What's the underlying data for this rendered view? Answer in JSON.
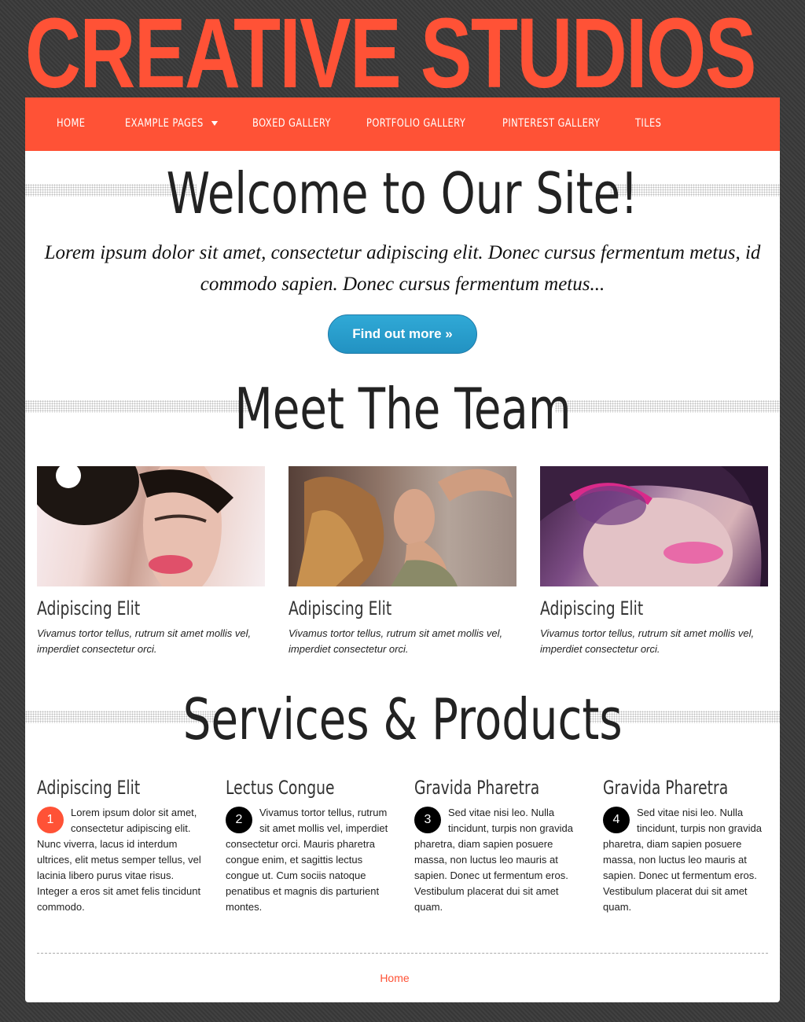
{
  "site": {
    "title": "CREATIVE STUDIOS"
  },
  "nav": {
    "items": [
      {
        "label": "HOME"
      },
      {
        "label": "EXAMPLE PAGES"
      },
      {
        "label": "BOXED GALLERY"
      },
      {
        "label": "PORTFOLIO GALLERY"
      },
      {
        "label": "PINTEREST GALLERY"
      },
      {
        "label": "TILES"
      }
    ]
  },
  "welcome": {
    "heading": "Welcome to Our Site!",
    "intro": "Lorem ipsum dolor sit amet, consectetur adipiscing elit. Donec cursus fermentum metus, id commodo sapien. Donec cursus fermentum metus...",
    "button_label": "Find out more »"
  },
  "team": {
    "heading": "Meet The Team",
    "members": [
      {
        "name": "Adipiscing Elit",
        "description": "Vivamus tortor tellus, rutrum sit amet mollis vel, imperdiet consectetur orci."
      },
      {
        "name": "Adipiscing Elit",
        "description": "Vivamus tortor tellus, rutrum sit amet mollis vel, imperdiet consectetur orci."
      },
      {
        "name": "Adipiscing Elit",
        "description": "Vivamus tortor tellus, rutrum sit amet mollis vel, imperdiet consectetur orci."
      }
    ]
  },
  "services": {
    "heading": "Services & Products",
    "items": [
      {
        "title": "Adipiscing Elit",
        "number": "1",
        "text": "Lorem ipsum dolor sit amet, consectetur adipiscing elit. Nunc viverra, lacus id interdum ultrices, elit metus semper tellus, vel lacinia libero purus vitae risus. Integer a eros sit amet felis tincidunt commodo."
      },
      {
        "title": "Lectus Congue",
        "number": "2",
        "text": "Vivamus tortor tellus, rutrum sit amet mollis vel, imperdiet consectetur orci. Mauris pharetra congue enim, et sagittis lectus congue ut. Cum sociis natoque penatibus et magnis dis parturient montes."
      },
      {
        "title": "Gravida Pharetra",
        "number": "3",
        "text": "Sed vitae nisi leo. Nulla tincidunt, turpis non gravida pharetra, diam sapien posuere massa, non luctus leo mauris at sapien. Donec ut fermentum eros. Vestibulum placerat dui sit amet quam."
      },
      {
        "title": "Gravida Pharetra",
        "number": "4",
        "text": "Sed vitae nisi leo. Nulla tincidunt, turpis non gravida pharetra, diam sapien posuere massa, non luctus leo mauris at sapien. Donec ut fermentum eros. Vestibulum placerat dui sit amet quam."
      }
    ]
  },
  "footer": {
    "link": "Home"
  },
  "colors": {
    "brand": "#ff5236",
    "button": "#2aa0cf",
    "badge_dark": "#000000"
  }
}
